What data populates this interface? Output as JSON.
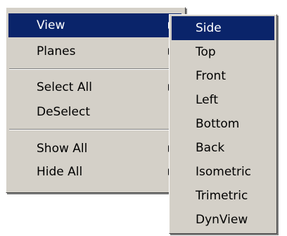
{
  "main_menu": {
    "items": [
      {
        "label": "View",
        "has_submenu": true,
        "selected": true
      },
      {
        "label": "Planes",
        "has_submenu": true,
        "selected": false
      },
      {
        "label": "Select All",
        "has_submenu": true,
        "selected": false
      },
      {
        "label": "DeSelect",
        "has_submenu": false,
        "selected": false
      },
      {
        "label": "Show All",
        "has_submenu": true,
        "selected": false
      },
      {
        "label": "Hide All",
        "has_submenu": true,
        "selected": false
      }
    ]
  },
  "view_submenu": {
    "items": [
      {
        "label": "Side",
        "selected": true
      },
      {
        "label": "Top",
        "selected": false
      },
      {
        "label": "Front",
        "selected": false
      },
      {
        "label": "Left",
        "selected": false
      },
      {
        "label": "Bottom",
        "selected": false
      },
      {
        "label": "Back",
        "selected": false
      },
      {
        "label": "Isometric",
        "selected": false
      },
      {
        "label": "Trimetric",
        "selected": false
      },
      {
        "label": "DynView",
        "selected": false
      }
    ]
  },
  "colors": {
    "menu_background": "#d4d0c8",
    "highlight": "#0a246a",
    "highlight_text": "#ffffff"
  }
}
